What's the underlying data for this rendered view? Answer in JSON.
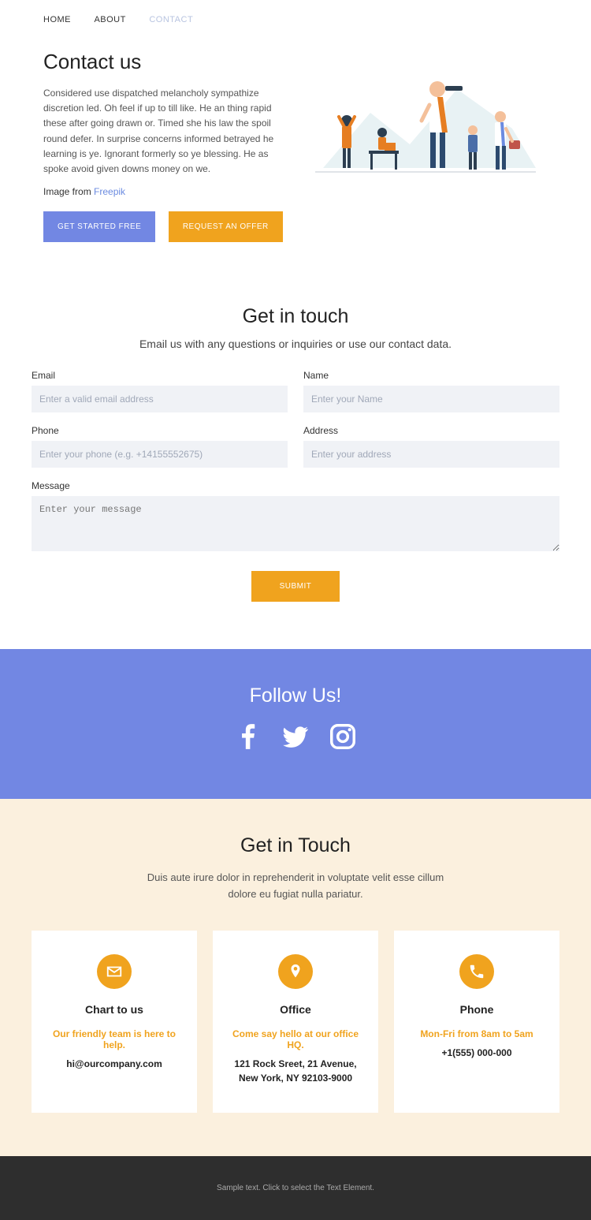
{
  "nav": {
    "items": [
      "HOME",
      "ABOUT",
      "CONTACT"
    ],
    "active": 2
  },
  "hero": {
    "title": "Contact us",
    "text": "Considered use dispatched melancholy sympathize discretion led. Oh feel if up to till like. He an thing rapid these after going drawn or. Timed she his law the spoil round defer. In surprise concerns informed betrayed he learning is ye. Ignorant formerly so ye blessing. He as spoke avoid given downs money on we.",
    "credit_text": "Image from ",
    "credit_link": "Freepik",
    "btn_primary": "GET STARTED FREE",
    "btn_secondary": "REQUEST AN OFFER"
  },
  "form": {
    "title": "Get in touch",
    "subtitle": "Email us with any questions or inquiries or use our contact data.",
    "email_label": "Email",
    "email_ph": "Enter a valid email address",
    "name_label": "Name",
    "name_ph": "Enter your Name",
    "phone_label": "Phone",
    "phone_ph": "Enter your phone (e.g. +14155552675)",
    "address_label": "Address",
    "address_ph": "Enter your address",
    "message_label": "Message",
    "message_ph": "Enter your message",
    "submit": "SUBMIT"
  },
  "follow": {
    "title": "Follow Us!"
  },
  "touch": {
    "title": "Get in Touch",
    "subtitle": "Duis aute irure dolor in reprehenderit in voluptate velit esse cillum dolore eu fugiat nulla pariatur.",
    "cards": [
      {
        "title": "Chart to us",
        "line1": "Our friendly team is here to help.",
        "line2": "hi@ourcompany.com"
      },
      {
        "title": "Office",
        "line1": "Come say hello at our office HQ.",
        "line2": "121 Rock Sreet, 21 Avenue,\nNew York, NY 92103-9000"
      },
      {
        "title": "Phone",
        "line1": "Mon-Fri from 8am to 5am",
        "line2": "+1(555) 000-000"
      }
    ]
  },
  "footer": {
    "text": "Sample text. Click to select the Text Element."
  }
}
